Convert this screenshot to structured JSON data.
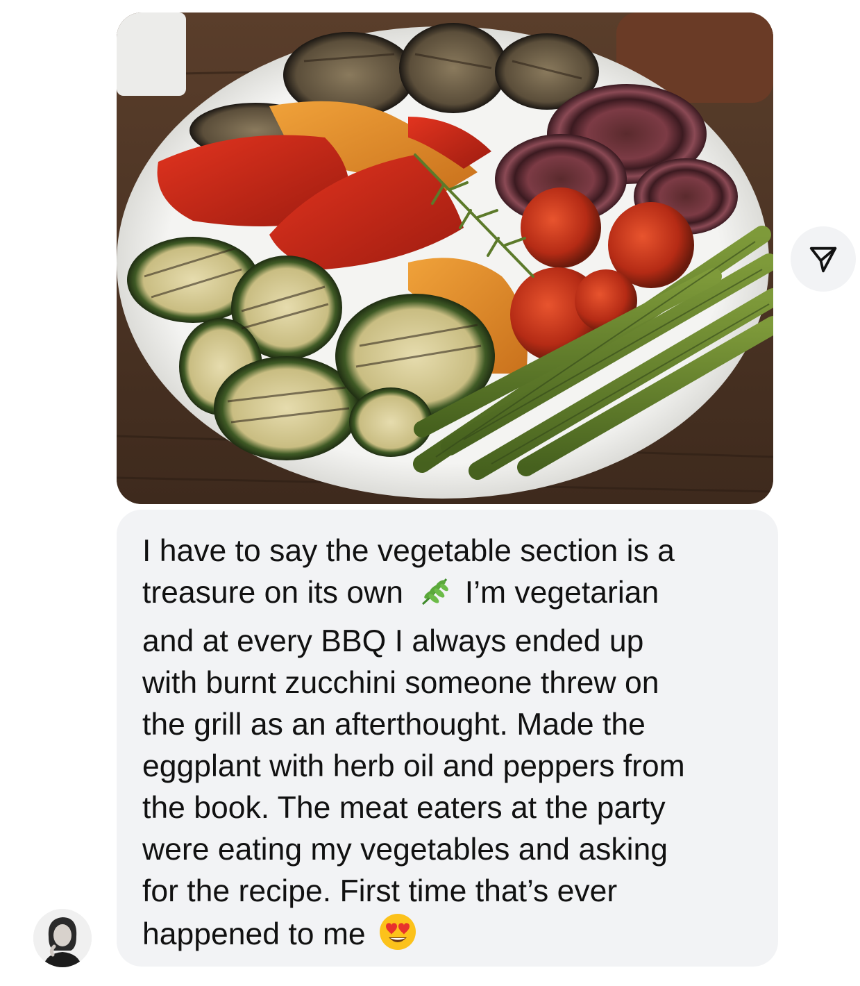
{
  "conversation": {
    "shared_image": {
      "icon": "photo-grilled-vegetables"
    },
    "share_button": {
      "icon": "paper-plane-icon"
    },
    "message": {
      "line1": "I have to say the vegetable section is a",
      "line2a": "treasure on its own",
      "line2_emoji": "herb-emoji",
      "line2b": "I’m vegetarian",
      "line3": "and at every BBQ I always ended up",
      "line4": "with burnt zucchini someone threw on",
      "line5": "the grill as an afterthought. Made the",
      "line6": "eggplant with herb oil and peppers from",
      "line7": "the book. The meat eaters at the party",
      "line8": "were eating my vegetables and asking",
      "line9": "for the recipe. First time that’s ever",
      "line10a": "happened to me",
      "line10_emoji": "heart-eyes-emoji"
    },
    "sender_avatar": {
      "icon": "avatar"
    },
    "colors": {
      "bubble_background": "#f2f3f5",
      "text": "#111111",
      "page_background": "#ffffff"
    }
  }
}
